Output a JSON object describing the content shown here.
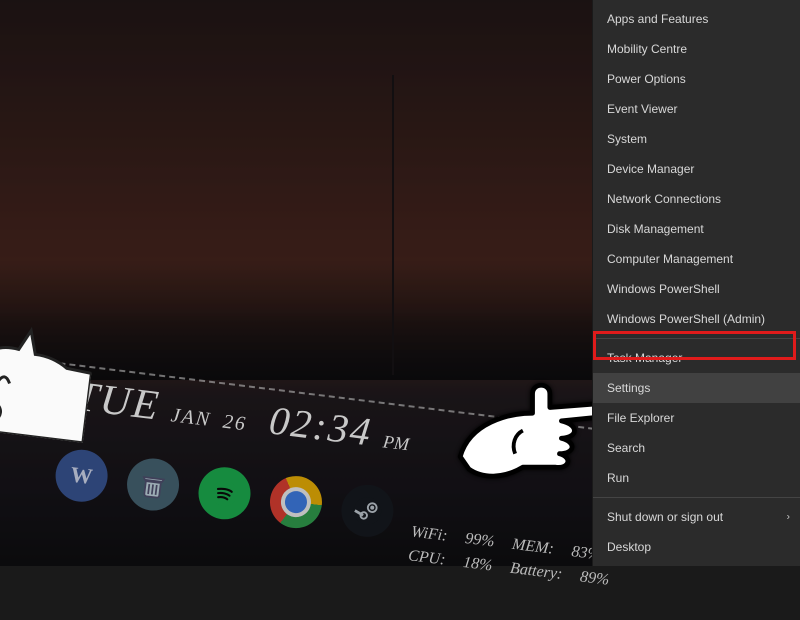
{
  "clock": {
    "day": "TUE",
    "month": "JAN",
    "daynum": "26",
    "time": "02:34",
    "ampm": "PM"
  },
  "dock": {
    "word": "W"
  },
  "stats": {
    "wifi_label": "WiFi:",
    "wifi_value": "99%",
    "mem_label": "MEM:",
    "mem_value": "83%",
    "cpu_label": "CPU:",
    "cpu_value": "18%",
    "bat_label": "Battery:",
    "bat_value": "89%"
  },
  "menu": {
    "items": [
      {
        "label": "Apps and Features"
      },
      {
        "label": "Mobility Centre"
      },
      {
        "label": "Power Options"
      },
      {
        "label": "Event Viewer"
      },
      {
        "label": "System"
      },
      {
        "label": "Device Manager"
      },
      {
        "label": "Network Connections"
      },
      {
        "label": "Disk Management"
      },
      {
        "label": "Computer Management"
      },
      {
        "label": "Windows PowerShell"
      },
      {
        "label": "Windows PowerShell (Admin)"
      }
    ],
    "items2": [
      {
        "label": "Task Manager"
      },
      {
        "label": "Settings",
        "highlight": true
      },
      {
        "label": "File Explorer"
      },
      {
        "label": "Search"
      },
      {
        "label": "Run"
      }
    ],
    "items3": [
      {
        "label": "Shut down or sign out",
        "submenu": true
      },
      {
        "label": "Desktop"
      }
    ]
  }
}
